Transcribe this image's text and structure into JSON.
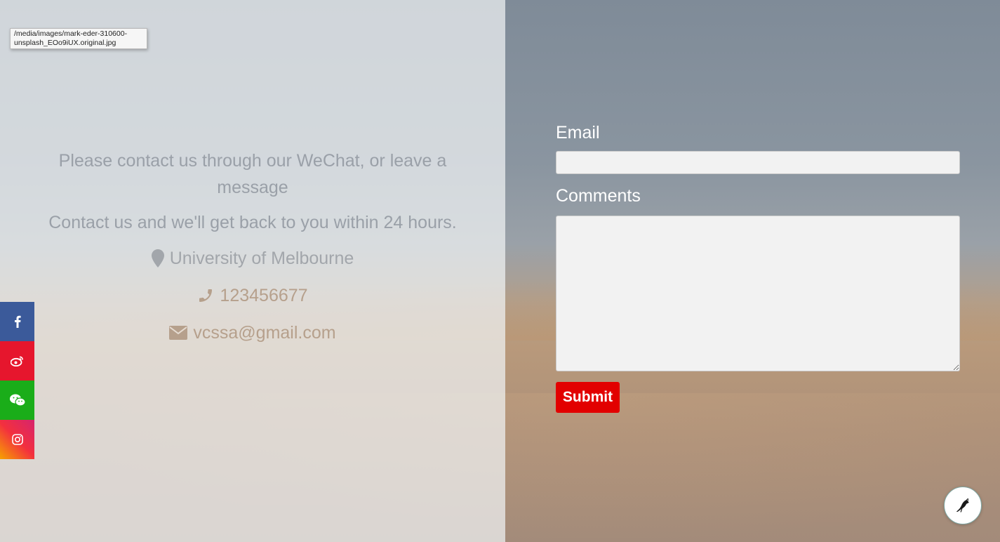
{
  "tooltip": {
    "text": "/media/images/mark-eder-310600-unsplash_EOo9iUX.original.jpg"
  },
  "contact": {
    "line1": "Please contact us through our WeChat, or leave a message",
    "line2": "Contact us and we'll get back to you within 24 hours.",
    "address": "University of Melbourne",
    "phone": "123456677",
    "email": "vcssa@gmail.com"
  },
  "social": [
    "facebook-icon",
    "weibo-icon",
    "wechat-icon",
    "instagram-icon"
  ],
  "form": {
    "email_label": "Email",
    "email_value": "",
    "comments_label": "Comments",
    "comments_value": "",
    "submit_label": "Submit"
  },
  "colors": {
    "submit": "#e20000",
    "facebook": "#3b5a9a",
    "weibo": "#e6162d",
    "wechat": "#1aad19"
  }
}
